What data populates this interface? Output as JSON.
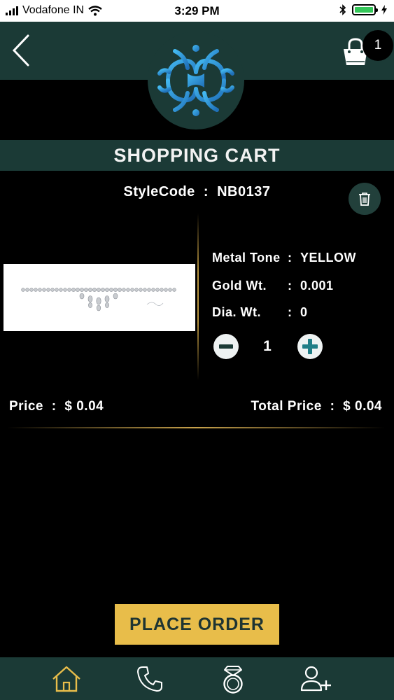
{
  "status_bar": {
    "carrier": "Vodafone IN",
    "time": "3:29 PM"
  },
  "header": {
    "cart_count": "1",
    "logo_color": "#2f8fd8"
  },
  "page": {
    "title": "SHOPPING CART"
  },
  "item": {
    "style_code_label": "StyleCode",
    "style_code_sep": ":",
    "style_code": "NB0137",
    "metal_tone_label": "Metal Tone",
    "metal_tone_sep": ":",
    "metal_tone": "YELLOW",
    "gold_wt_label": "Gold Wt.",
    "gold_wt_sep": ":",
    "gold_wt": "0.001",
    "dia_wt_label": "Dia. Wt.",
    "dia_wt_sep": ":",
    "dia_wt": "0",
    "quantity": "1"
  },
  "pricing": {
    "price_label": "Price",
    "price_sep": ":",
    "price": "$ 0.04",
    "total_label": "Total Price",
    "total_sep": ":",
    "total": "$ 0.04"
  },
  "actions": {
    "place_order": "PLACE ORDER"
  },
  "tabs": [
    {
      "icon": "home-icon",
      "active": true
    },
    {
      "icon": "phone-icon",
      "active": false
    },
    {
      "icon": "ring-icon",
      "active": false
    },
    {
      "icon": "add-user-icon",
      "active": false
    }
  ],
  "colors": {
    "header_bg": "#1b3a36",
    "accent_gold": "#e8bd4a",
    "active_tab": "#e8bd4a"
  }
}
